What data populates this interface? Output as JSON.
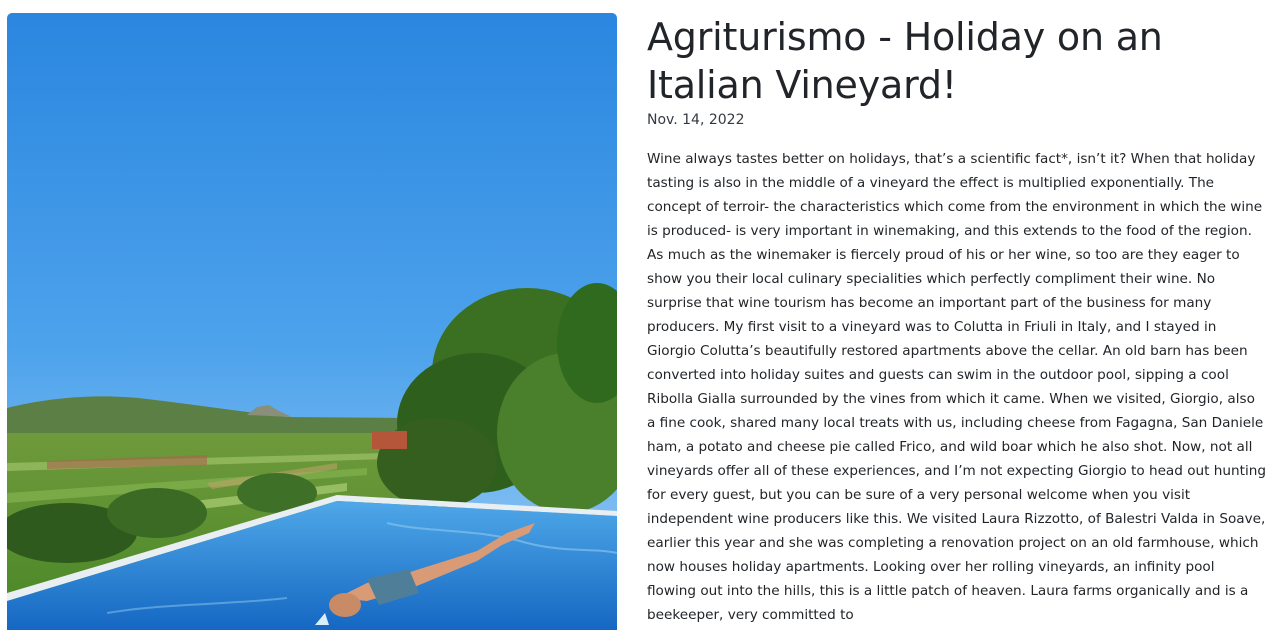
{
  "post": {
    "title": "Agriturismo - Holiday on an Italian Vineyard!",
    "date": "Nov. 14, 2022",
    "body": "Wine always tastes better on holidays, that’s a scientific fact*, isn’t it? When that holiday tasting is also in the middle of a vineyard the effect is multiplied exponentially. The concept of terroir- the characteristics which come from the environment in which the wine is produced- is very important in winemaking, and this extends to the food of the region. As much as the winemaker is fiercely proud of his or her wine, so too are they eager to show you their local culinary specialities which perfectly compliment their wine. No surprise that wine tourism has become an important part of the business for many producers. My first visit to a vineyard was to Colutta in Friuli in Italy, and I stayed in Giorgio Colutta’s beautifully restored apartments above the cellar. An old barn has been converted into holiday suites and guests can swim in the outdoor pool, sipping a cool Ribolla Gialla surrounded by the vines from which it came. When we visited, Giorgio, also a fine cook, shared many local treats with us, including cheese from Fagagna, San Daniele ham, a potato and cheese pie called Frico, and wild boar which he also shot. Now, not all vineyards offer all of these experiences, and I’m not expecting Giorgio to head out hunting for every guest, but you can be sure of a very personal welcome when you visit independent wine producers like this. We visited Laura Rizzotto, of Balestri Valda in Soave, earlier this year and she was completing a renovation project on an old farmhouse, which now houses holiday apartments. Looking over her rolling vineyards, an infinity pool flowing out into the hills, this is a little patch of heaven. Laura farms organically and is a beekeeper, very committed to"
  },
  "colors": {
    "sky_top": "#2f8ee3",
    "sky_bottom": "#8cc4f2",
    "pool": "#1f7fd6",
    "foliage": "#3f7a2a"
  }
}
